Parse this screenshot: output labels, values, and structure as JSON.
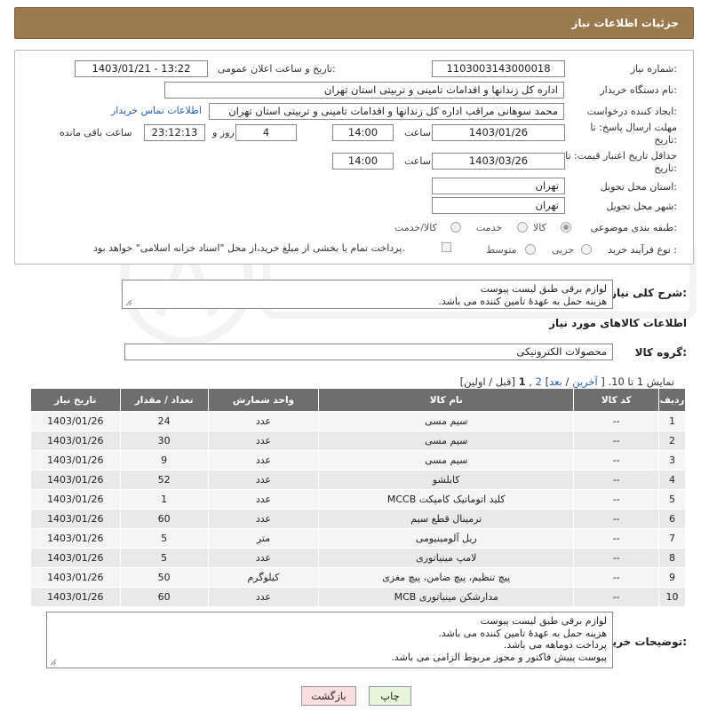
{
  "header": {
    "title": "جزئیات اطلاعات نیاز"
  },
  "form": {
    "need_number_label": "شماره نیاز:",
    "need_number": "1103003143000018",
    "announce_label": "تاریخ و ساعت اعلان عمومی:",
    "announce_value": "1403/01/21 - 13:22",
    "buyer_org_label": "نام دستگاه خریدار:",
    "buyer_org": "اداره کل زندانها و اقدامات تامینی و تربیتی استان تهران",
    "creator_label": "ایجاد کننده درخواست:",
    "creator": "محمد سوهانی مراقب  اداره کل زندانها و اقدامات تامینی و تربیتی استان تهران",
    "contact_link": "اطلاعات تماس خریدار",
    "reply_deadline_label_1": "مهلت ارسال پاسخ: تا",
    "reply_deadline_label_2": "تاریخ:",
    "reply_date": "1403/01/26",
    "time_label": "ساعت",
    "reply_time": "14:00",
    "days_value": "4",
    "days_label": "روز و",
    "remaining_time": "23:12:13",
    "remaining_label": "ساعت باقی مانده",
    "validity_label_1": "حداقل تاریخ اعتبار قیمت: تا",
    "validity_label_2": "تاریخ:",
    "validity_date": "1403/03/26",
    "validity_time": "14:00",
    "province_label": "استان محل تحویل:",
    "province": "تهران",
    "city_label": "شهر محل تحویل:",
    "city": "تهران",
    "category_label": "طبقه بندی موضوعی:",
    "category_options": [
      "کالا",
      "خدمت",
      "کالا/خدمت"
    ],
    "category_selected": "کالا",
    "process_label": "نوع فرآیند خرید :",
    "process_options": [
      "جزیی",
      "متوسط"
    ],
    "payment_note": "پرداخت تمام یا بخشی از مبلغ خرید،از محل \"اسناد خزانه اسلامی\" خواهد بود."
  },
  "description": {
    "label": "شرح کلی نیاز:",
    "lines": [
      "لوازم برقی طبق لیست پیوست",
      "هزینه حمل به عهدۀ تامین کننده می باشد."
    ]
  },
  "goods_info": {
    "heading": "اطلاعات کالاهای مورد نیاز",
    "group_label": "گروه کالا:",
    "group_value": "محصولات الکترونیکی"
  },
  "pagination": {
    "prefix": "نمایش 1 تا 10.",
    "open_bracket": "[",
    "last": "آخرین",
    "sep1": "/",
    "next": "بعد",
    "close_bracket": "]",
    "page2": "2",
    "comma": ",",
    "page1": "1",
    "prev_first": "[قبل / اولین]"
  },
  "table": {
    "headers": [
      "ردیف",
      "کد کالا",
      "نام کالا",
      "واحد شمارش",
      "تعداد / مقدار",
      "تاریخ نیاز"
    ],
    "rows": [
      [
        "1",
        "--",
        "سیم مسی",
        "عدد",
        "24",
        "1403/01/26"
      ],
      [
        "2",
        "--",
        "سیم مسی",
        "عدد",
        "30",
        "1403/01/26"
      ],
      [
        "3",
        "--",
        "سیم مسی",
        "عدد",
        "9",
        "1403/01/26"
      ],
      [
        "4",
        "--",
        "کابلشو",
        "عدد",
        "52",
        "1403/01/26"
      ],
      [
        "5",
        "--",
        "کلید اتوماتیک کامپکت MCCB",
        "عدد",
        "1",
        "1403/01/26"
      ],
      [
        "6",
        "--",
        "ترمینال قطع سیم",
        "عدد",
        "60",
        "1403/01/26"
      ],
      [
        "7",
        "--",
        "ریل آلومینیومی",
        "متر",
        "5",
        "1403/01/26"
      ],
      [
        "8",
        "--",
        "لامپ مینیاتوری",
        "عدد",
        "5",
        "1403/01/26"
      ],
      [
        "9",
        "--",
        "پیچ تنظیم، پیچ ضامن، پیچ مغزی",
        "کیلوگرم",
        "50",
        "1403/01/26"
      ],
      [
        "10",
        "--",
        "مدارشکن مینیاتوری MCB",
        "عدد",
        "60",
        "1403/01/26"
      ]
    ]
  },
  "buyer_notes": {
    "label": "توضیحات خریدار:",
    "lines": [
      "لوازم برقی طبق لیست پیوست",
      "هزینه حمل به عهدۀ تامین کننده می باشد.",
      "پرداخت دوماهه می باشد.",
      "پیوست پییش فاکتور و مجوز مربوط الزامی می باشد."
    ]
  },
  "buttons": {
    "print": "چاپ",
    "back": "بازگشت"
  },
  "colors": {
    "header_bg": "#9a7a4e",
    "table_header_bg": "#6e6e6e",
    "link": "#2a5db0",
    "back_button_bg": "#f8dede",
    "print_button_bg": "#e6f5dc"
  }
}
